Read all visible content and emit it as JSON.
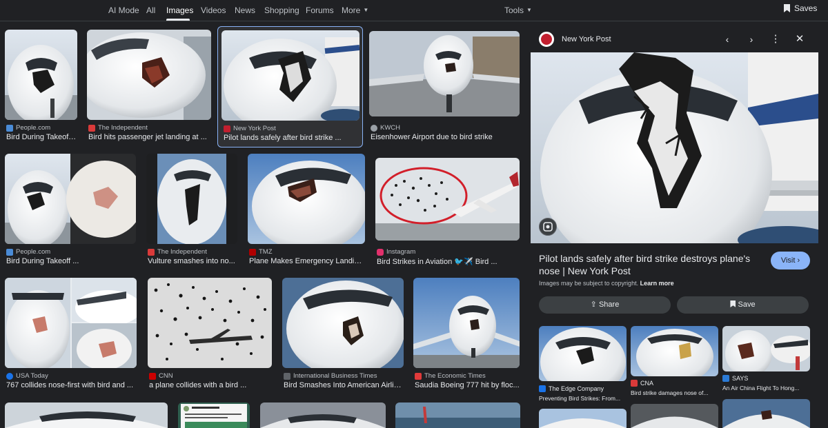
{
  "tabs": [
    "AI Mode",
    "All",
    "Images",
    "Videos",
    "News",
    "Shopping",
    "Forums",
    "More"
  ],
  "tools_label": "Tools",
  "saves_label": "Saves",
  "results": [
    {
      "source": "People.com",
      "caption": "Bird During Takeoff ...",
      "fav_color": "#4a8bd6"
    },
    {
      "source": "The Independent",
      "caption": "Bird hits passenger jet landing at ...",
      "fav_color": "#d93a3a"
    },
    {
      "source": "New York Post",
      "caption": "Pilot lands safely after bird strike ...",
      "fav_color": "#c21f2f"
    },
    {
      "source": "KWCH",
      "caption": "Eisenhower Airport due to bird strike",
      "fav_color": "#9aa0a6"
    },
    {
      "source": "People.com",
      "caption": "Bird During Takeoff ...",
      "fav_color": "#4a8bd6"
    },
    {
      "source": "The Independent",
      "caption": "Vulture smashes into no...",
      "fav_color": "#d93a3a"
    },
    {
      "source": "TMZ",
      "caption": "Plane Makes Emergency Landin...",
      "fav_color": "#b00000"
    },
    {
      "source": "Instagram",
      "caption": "Bird Strikes in Aviation 🐦✈️ Bird ...",
      "fav_color": "#e1306c"
    },
    {
      "source": "USA Today",
      "caption": "767 collides nose-first with bird and ...",
      "fav_color": "#1a73e8"
    },
    {
      "source": "CNN",
      "caption": "a plane collides with a bird ...",
      "fav_color": "#cc0000"
    },
    {
      "source": "International Business Times",
      "caption": "Bird Smashes Into American Airlin...",
      "fav_color": "#5f6368"
    },
    {
      "source": "The Economic Times",
      "caption": "Saudia Boeing 777 hit by floc...",
      "fav_color": "#e03a3a"
    }
  ],
  "panel": {
    "source": "New York Post",
    "title": "Pilot lands safely after bird strike destroys plane's nose | New York Post",
    "visit_label": "Visit",
    "copyright_text": "Images may be subject to copyright.",
    "learn_more": "Learn more",
    "share_label": "Share",
    "save_label": "Save",
    "related": [
      {
        "source": "The Edge Company",
        "caption": "Preventing Bird Strikes: From...",
        "fav_color": "#1a73e8"
      },
      {
        "source": "CNA",
        "caption": "Bird strike damages nose of...",
        "fav_color": "#d93a3a"
      },
      {
        "source": "SAYS",
        "caption": "An Air China Flight To Hong...",
        "fav_color": "#2b7bd6"
      }
    ]
  },
  "colors": {
    "background": "#202124",
    "accent": "#8ab4f8",
    "text": "#e8eaed",
    "muted": "#bdc1c6"
  }
}
